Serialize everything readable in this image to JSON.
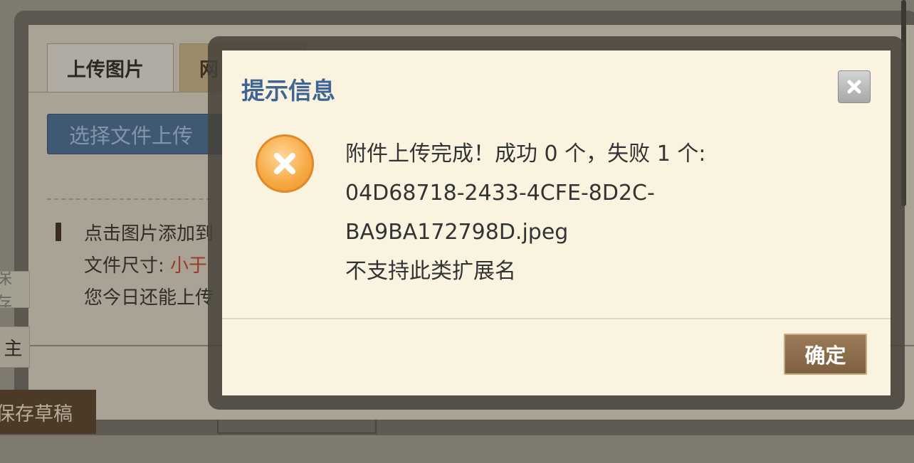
{
  "background": {
    "tabs": [
      "上传图片",
      "网"
    ],
    "upload_button": "选择文件上传",
    "hint_line1": "点击图片添加到",
    "hint_line2_prefix": "文件尺寸: ",
    "hint_line2_value": "小于",
    "hint_line3": "您今日还能上传",
    "save_fragment": "保存",
    "main_fragment": "主",
    "save_button": "保存草稿"
  },
  "dialog": {
    "title": "提示信息",
    "close_icon": "close-icon",
    "status_icon": "error-icon",
    "message": [
      "附件上传完成！成功 0 个，失败 1 个:",
      "04D68718-2433-4CFE-8D2C-",
      "BA9BA172798D.jpeg",
      "不支持此类扩展名"
    ],
    "ok_button": "确定"
  },
  "colors": {
    "dialog_bg": "#faf3df",
    "title": "#3f6594",
    "ok_button": "#8c6c4c",
    "error_icon": "#f7a944"
  }
}
